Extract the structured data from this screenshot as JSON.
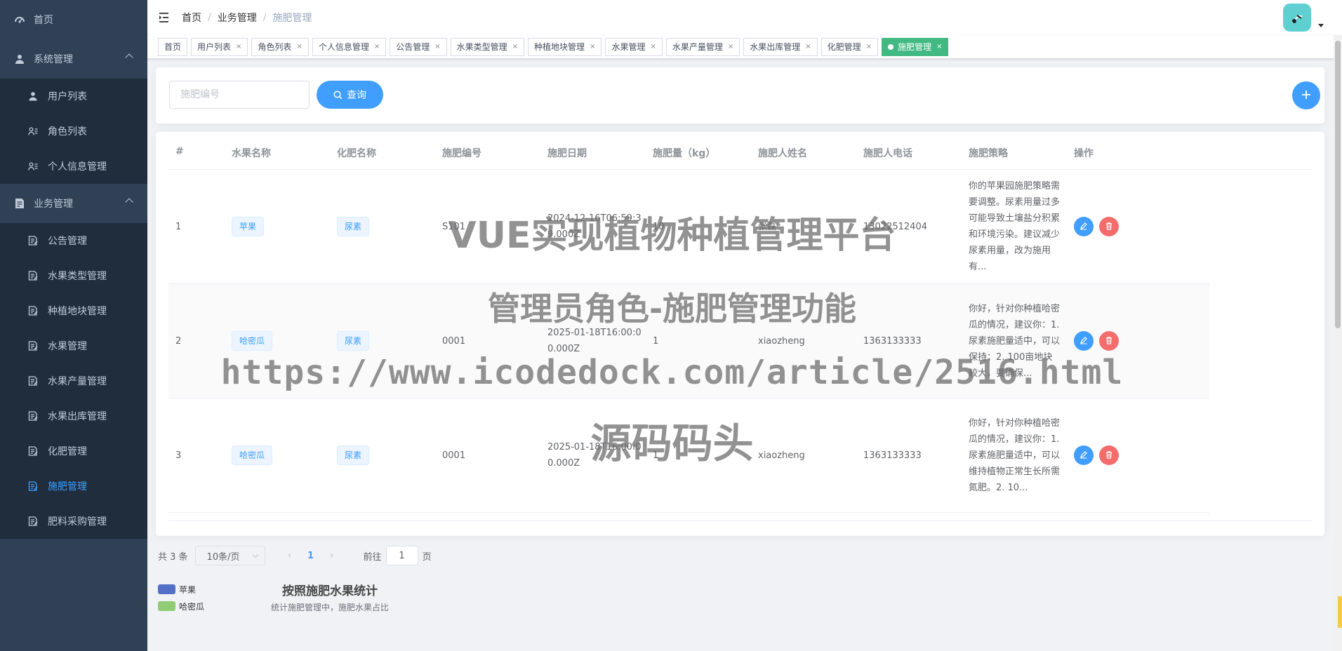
{
  "sidebar": {
    "home": "首页",
    "system": {
      "label": "系统管理",
      "items": [
        "用户列表",
        "角色列表",
        "个人信息管理"
      ]
    },
    "business": {
      "label": "业务管理",
      "items": [
        "公告管理",
        "水果类型管理",
        "种植地块管理",
        "水果管理",
        "水果产量管理",
        "水果出库管理",
        "化肥管理",
        "施肥管理",
        "肥料采购管理"
      ],
      "active": "施肥管理"
    }
  },
  "breadcrumb": [
    "首页",
    "业务管理",
    "施肥管理"
  ],
  "tags": [
    "首页",
    "用户列表",
    "角色列表",
    "个人信息管理",
    "公告管理",
    "水果类型管理",
    "种植地块管理",
    "水果管理",
    "水果产量管理",
    "水果出库管理",
    "化肥管理",
    "施肥管理"
  ],
  "active_tag": "施肥管理",
  "search": {
    "placeholder": "施肥编号",
    "button": "查询"
  },
  "table": {
    "headers": [
      "#",
      "水果名称",
      "化肥名称",
      "施肥编号",
      "施肥日期",
      "施肥量（kg）",
      "施肥人姓名",
      "施肥人电话",
      "施肥策略",
      "操作"
    ],
    "rows": [
      {
        "index": "1",
        "fruit": "苹果",
        "fertilizer": "尿素",
        "code": "S101",
        "date": "2024-12-16T06:59:39.000Z",
        "amount": "10",
        "person": "张磊",
        "phone": "13022512404",
        "strategy": "你的苹果园施肥策略需要调整。尿素用量过多可能导致土壤盐分积累和环境污染。建议减少尿素用量，改为施用有..."
      },
      {
        "index": "2",
        "fruit": "哈密瓜",
        "fertilizer": "尿素",
        "code": "0001",
        "date": "2025-01-18T16:00:00.000Z",
        "amount": "1",
        "person": "xiaozheng",
        "phone": "1363133333",
        "strategy": "你好，针对你种植哈密瓜的情况，建议你：1. 尿素施肥量适中，可以保持；2. 100亩地块较大，要确保..."
      },
      {
        "index": "3",
        "fruit": "哈密瓜",
        "fertilizer": "尿素",
        "code": "0001",
        "date": "2025-01-18T16:00:00.000Z",
        "amount": "1",
        "person": "xiaozheng",
        "phone": "1363133333",
        "strategy": "你好，针对你种植哈密瓜的情况，建议你：1. 尿素施肥量适中，可以维持植物正常生长所需氮肥。2. 10..."
      }
    ]
  },
  "pagination": {
    "total": "共 3 条",
    "page_size": "10条/页",
    "current_page": "1",
    "goto_prefix": "前往",
    "goto_value": "1",
    "goto_suffix": "页"
  },
  "chart": {
    "title": "按照施肥水果统计",
    "subtitle": "统计施肥管理中，施肥水果占比",
    "legend": [
      {
        "name": "苹果",
        "color": "#5470c6"
      },
      {
        "name": "哈密瓜",
        "color": "#91cc75"
      }
    ]
  },
  "watermark": [
    "VUE实现植物种植管理平台",
    "管理员角色-施肥管理功能",
    "https://www.icodedock.com/article/2516.html",
    "源码码头"
  ],
  "colors": {
    "sidebar_bg": "#304156",
    "submenu_bg": "#1f2d3d",
    "primary": "#409eff",
    "danger": "#f56c6c",
    "active_tag": "#42b983"
  }
}
